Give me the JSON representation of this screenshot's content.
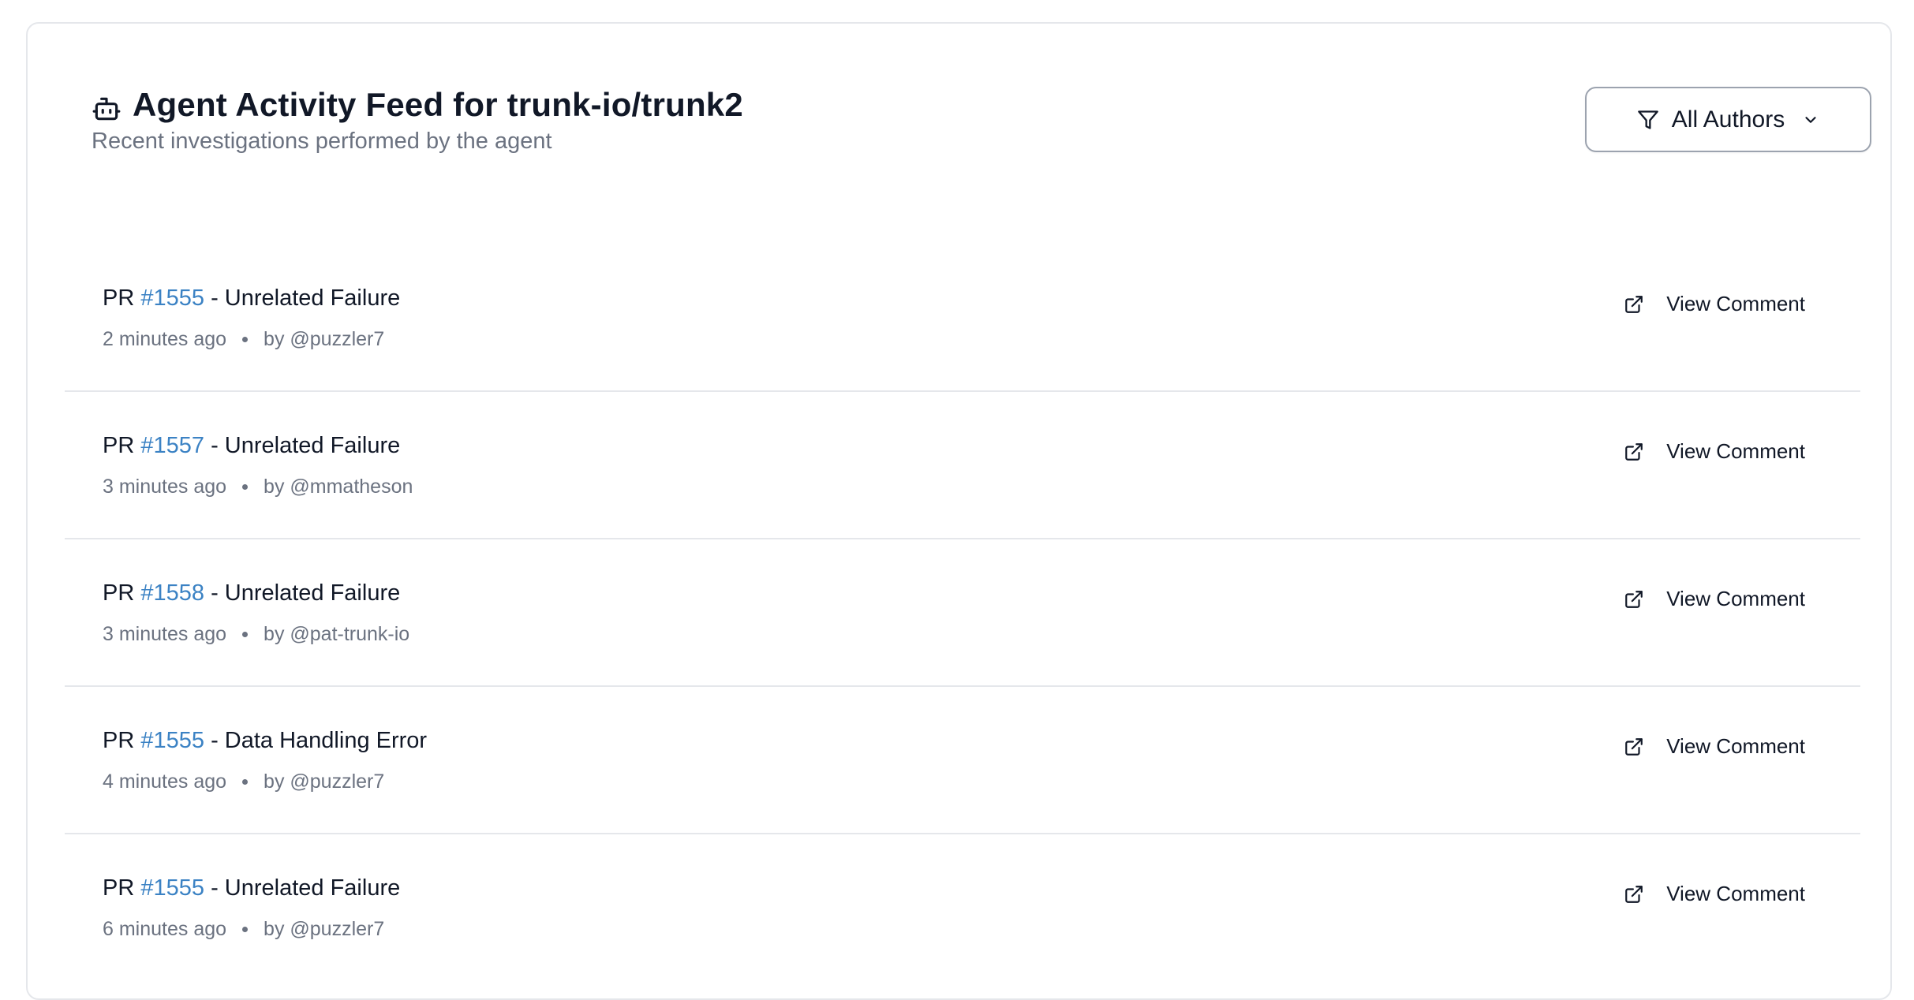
{
  "header": {
    "title": "Agent Activity Feed for trunk-io/trunk2",
    "subtitle": "Recent investigations performed by the agent",
    "icon": "robot-icon"
  },
  "filter": {
    "label": "All Authors",
    "icon": "filter-icon"
  },
  "items": [
    {
      "prefix": "PR",
      "pr": "#1555",
      "suffix": "- Unrelated Failure",
      "time": "2 minutes ago",
      "author": "by @puzzler7",
      "action": "View Comment"
    },
    {
      "prefix": "PR",
      "pr": "#1557",
      "suffix": "- Unrelated Failure",
      "time": "3 minutes ago",
      "author": "by @mmatheson",
      "action": "View Comment"
    },
    {
      "prefix": "PR",
      "pr": "#1558",
      "suffix": "- Unrelated Failure",
      "time": "3 minutes ago",
      "author": "by @pat-trunk-io",
      "action": "View Comment"
    },
    {
      "prefix": "PR",
      "pr": "#1555",
      "suffix": "- Data Handling Error",
      "time": "4 minutes ago",
      "author": "by @puzzler7",
      "action": "View Comment"
    },
    {
      "prefix": "PR",
      "pr": "#1555",
      "suffix": "- Unrelated Failure",
      "time": "6 minutes ago",
      "author": "by @puzzler7",
      "action": "View Comment"
    }
  ],
  "colors": {
    "link": "#3b82c4",
    "muted": "#6b7280",
    "text": "#111827",
    "border": "#e5e7eb"
  }
}
